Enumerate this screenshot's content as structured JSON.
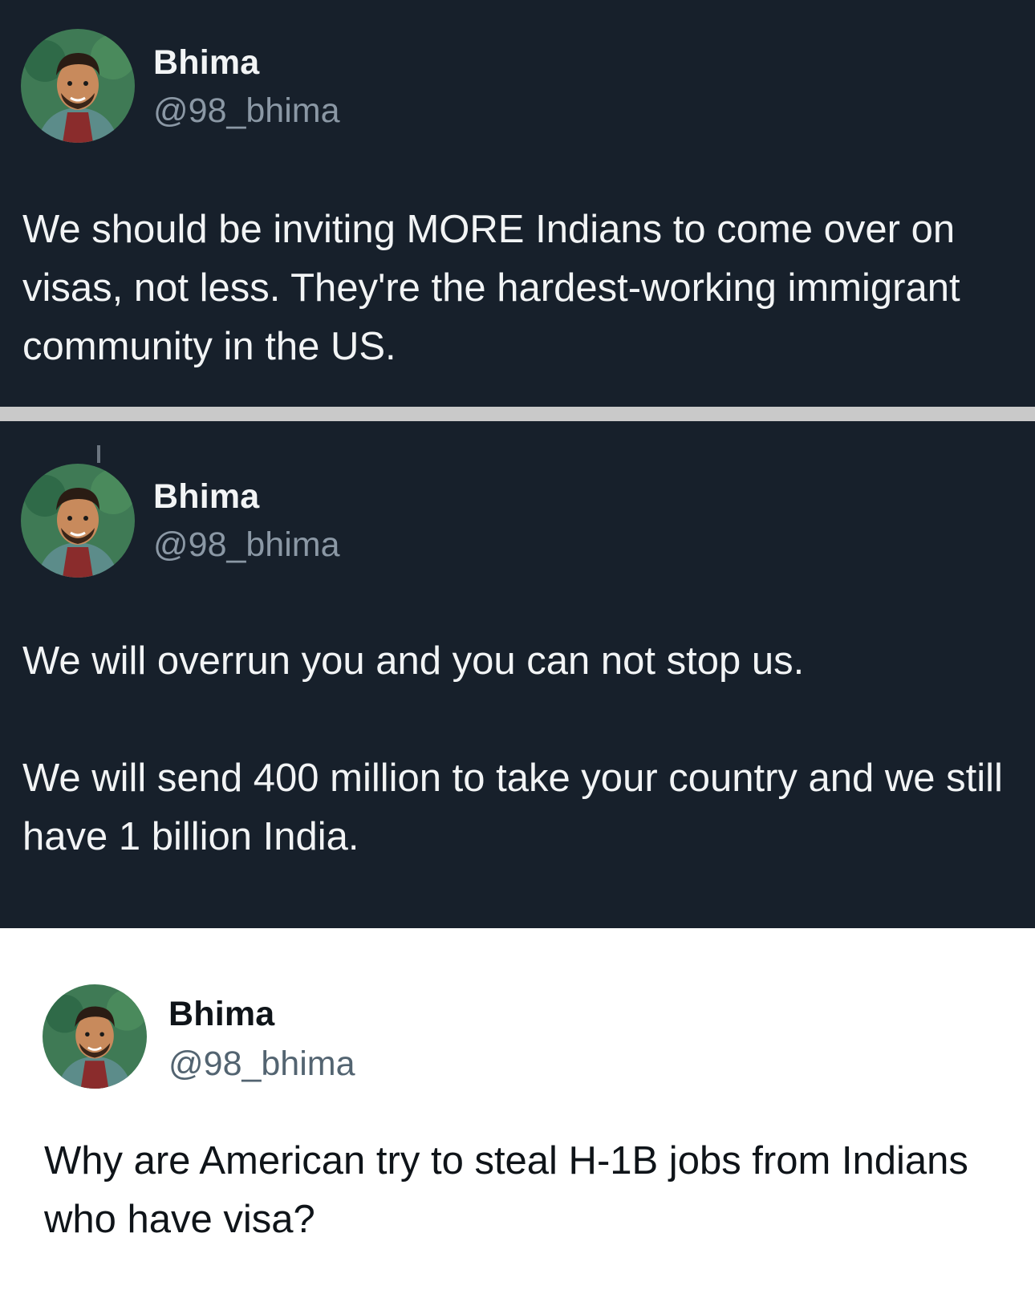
{
  "posts": [
    {
      "author": {
        "name": "Bhima",
        "handle": "@98_bhima",
        "avatar_icon": "avatar-illustration-icon"
      },
      "text": "We should be inviting MORE Indians to come over on visas, not less. They're the hardest-working immigrant community in the US.",
      "theme": "dark"
    },
    {
      "author": {
        "name": "Bhima",
        "handle": "@98_bhima",
        "avatar_icon": "avatar-illustration-icon"
      },
      "text": "We will overrun you and you can not stop us.\n\nWe will send 400 million to take your country and we still have 1 billion India.",
      "theme": "dark"
    },
    {
      "author": {
        "name": "Bhima",
        "handle": "@98_bhima",
        "avatar_icon": "avatar-illustration-icon"
      },
      "text": "Why are American try to steal H-1B jobs from Indians who have visa?",
      "theme": "light"
    }
  ],
  "colors": {
    "dark_background": "#17202b",
    "dark_text": "#f2f4f5",
    "dark_handle": "#8b98a5",
    "light_background": "#ffffff",
    "light_text": "#0f1419",
    "light_handle": "#536471",
    "divider": "#c9c9c9"
  }
}
